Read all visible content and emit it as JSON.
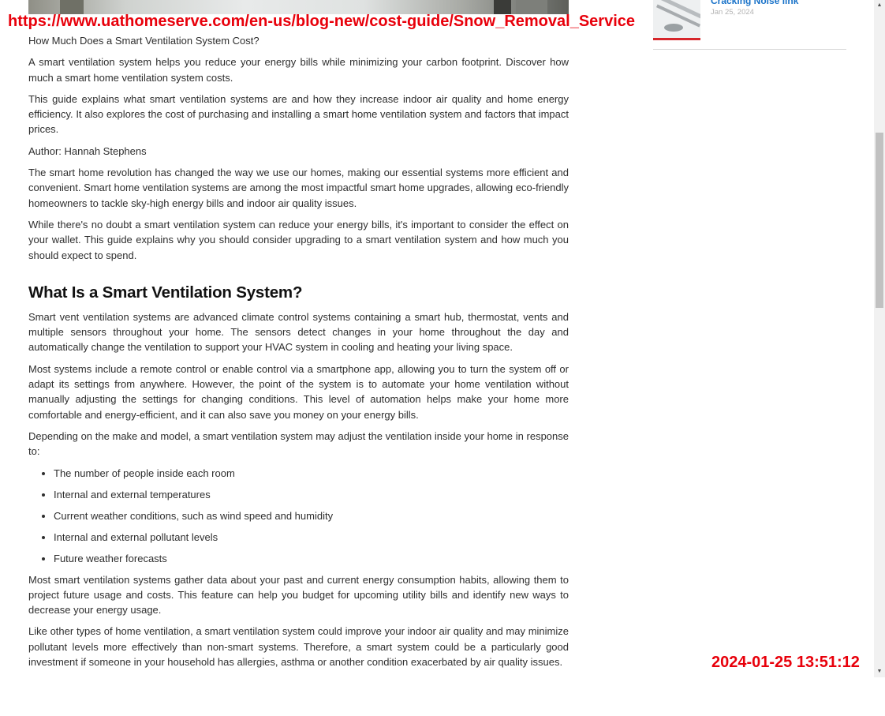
{
  "overlay": {
    "url": "https://www.uathomeserve.com/en-us/blog-new/cost-guide/Snow_Removal_Service",
    "timestamp": "2024-01-25 13:51:12"
  },
  "sidebar": {
    "card": {
      "link_text": "Cracking Noise link",
      "date": "Jan 25, 2024"
    }
  },
  "article": {
    "intro_title": "How Much Does a Smart Ventilation System Cost?",
    "intro_p1": "A smart ventilation system helps you reduce your energy bills while minimizing your carbon footprint. Discover how much a smart home ventilation system costs.",
    "intro_p2": "This guide explains what smart ventilation systems are and how they increase indoor air quality and home energy efficiency. It also explores the cost of purchasing and installing a smart home ventilation system and factors that impact prices.",
    "author": "Author: Hannah Stephens",
    "p1": "The smart home revolution has changed the way we use our homes, making our essential systems more efficient and convenient. Smart home ventilation systems are among the most impactful smart home upgrades, allowing eco-friendly homeowners to tackle sky-high energy bills and indoor air quality issues.",
    "p2": "While there's no doubt a smart ventilation system can reduce your energy bills, it's important to consider the effect on your wallet. This guide explains why you should consider upgrading to a smart ventilation system and how much you should expect to spend.",
    "section_heading": "What Is a Smart Ventilation System?",
    "s_p1": "Smart vent ventilation systems are advanced climate control systems containing a smart hub, thermostat, vents and multiple sensors throughout your home. The sensors detect changes in your home throughout the day and automatically change the ventilation to support your HVAC system in cooling and heating your living space.",
    "s_p2": "Most systems include a remote control or enable control via a smartphone app, allowing you to turn the system off or adapt its settings from anywhere. However, the point of the system is to automate your home ventilation without manually adjusting the settings for changing conditions. This level of automation helps make your home more comfortable and energy-efficient, and it can also save you money on your energy bills.",
    "s_p3": "Depending on the make and model, a smart ventilation system may adjust the ventilation inside your home in response to:",
    "list": [
      "The number of people inside each room",
      "Internal and external temperatures",
      "Current weather conditions, such as wind speed and humidity",
      "Internal and external pollutant levels",
      "Future weather forecasts"
    ],
    "s_p4": "Most smart ventilation systems gather data about your past and current energy consumption habits, allowing them to project future usage and costs. This feature can help you budget for upcoming utility bills and identify new ways to decrease your energy usage.",
    "s_p5": "Like other types of home ventilation, a smart ventilation system could improve your indoor air quality and may minimize pollutant levels more effectively than non-smart systems. Therefore, a smart system could be a particularly good investment if someone in your household has allergies, asthma or another condition exacerbated by air quality issues."
  },
  "scrollbar": {
    "up_icon": "scroll-up-arrow-icon",
    "down_icon": "scroll-down-arrow-icon"
  }
}
